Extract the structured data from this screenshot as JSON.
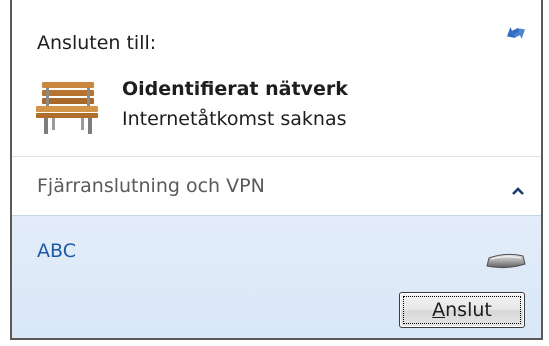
{
  "connected_section": {
    "label": "Ansluten till:",
    "refresh_icon": "refresh-arrows-icon",
    "network": {
      "icon": "bench-icon",
      "name": "Oidentifierat nätverk",
      "status": "Internetåtkomst saknas"
    }
  },
  "vpn_section": {
    "header": "Fjärranslutning och VPN",
    "collapse_icon": "chevron-up-icon",
    "items": [
      {
        "name": "ABC",
        "icon": "network-device-icon",
        "connect_label_first": "A",
        "connect_label_rest": "nslut"
      }
    ]
  },
  "colors": {
    "vpn_item_name": "#1c5aa8",
    "vpn_item_bg": "#dae7f7",
    "refresh_blue": "#2f6fc4"
  }
}
